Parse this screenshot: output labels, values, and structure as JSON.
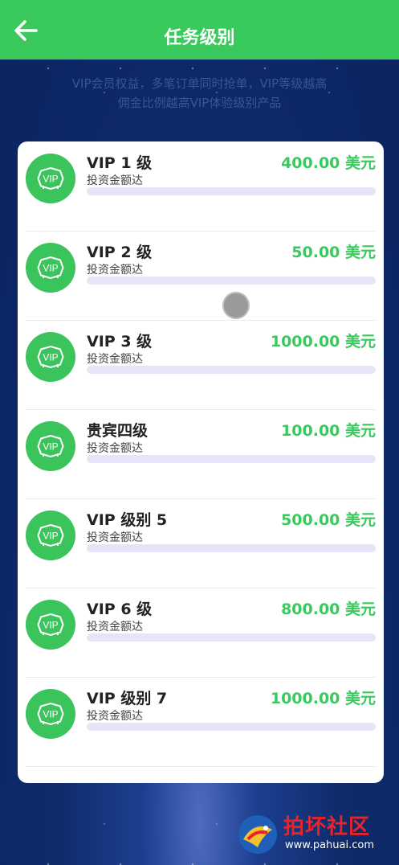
{
  "header": {
    "title": "任务级别"
  },
  "notice": "VIP会员权益，多笔订单同时抢单，VIP等级越高\n佣金比例越高VIP体验级别产品",
  "levels": [
    {
      "name": "VIP 1 级",
      "desc": "投资金额达",
      "amount": "400.00 美元",
      "progress": 0
    },
    {
      "name": "VIP 2 级",
      "desc": "投资金额达",
      "amount": "50.00 美元",
      "progress": 0
    },
    {
      "name": "VIP 3 级",
      "desc": "投资金额达",
      "amount": "1000.00 美元",
      "progress": 0
    },
    {
      "name": "贵宾四级",
      "desc": "投资金额达",
      "amount": "100.00 美元",
      "progress": 0
    },
    {
      "name": "VIP 级别 5",
      "desc": "投资金额达",
      "amount": "500.00 美元",
      "progress": 0
    },
    {
      "name": "VIP 6 级",
      "desc": "投资金额达",
      "amount": "800.00 美元",
      "progress": 0
    },
    {
      "name": "VIP 级别 7",
      "desc": "投资金额达",
      "amount": "1000.00 美元",
      "progress": 0
    }
  ],
  "watermark": {
    "text": "拍坏社区",
    "url": "www.pahuai.com"
  },
  "colors": {
    "accent": "#39c95d",
    "progress_track": "#e8e4f7"
  },
  "icons": {
    "back": "arrow-left-icon",
    "level": "vip-badge-icon"
  }
}
